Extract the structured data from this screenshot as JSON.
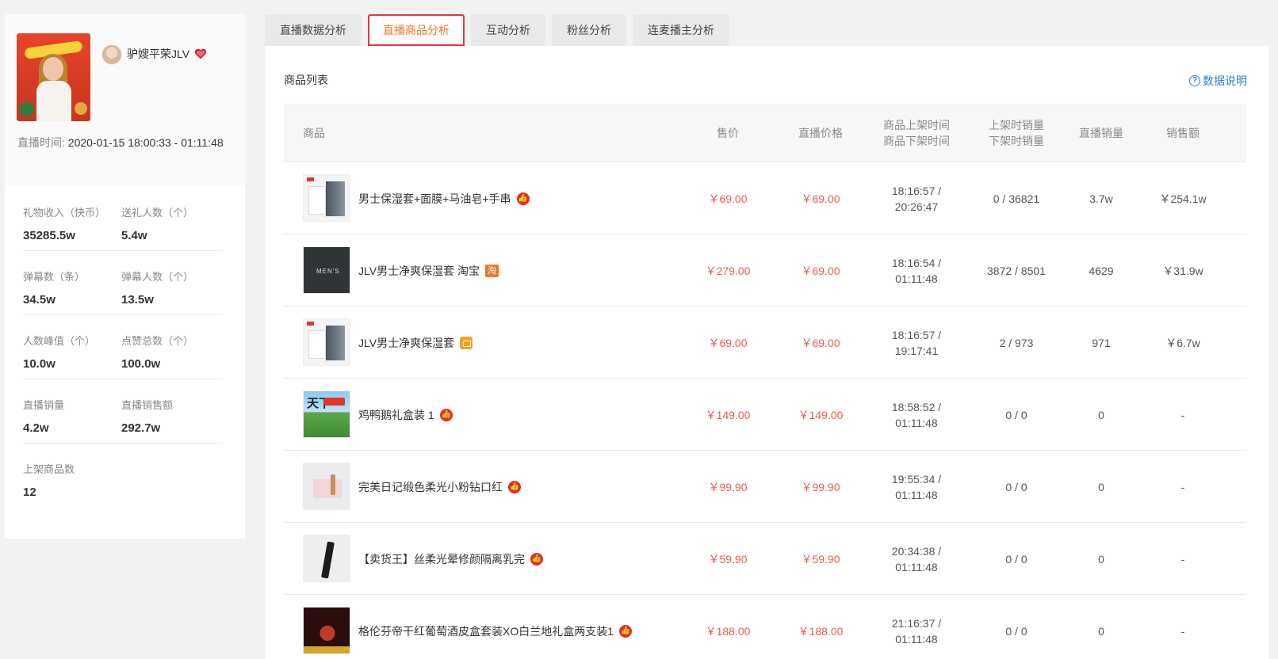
{
  "anchor": {
    "name": "驴嫂平荣JLV",
    "live_time_label": "直播时间:",
    "live_time_value": "2020-01-15 18:00:33 - 01:11:48"
  },
  "stats": [
    {
      "label": "礼物收入（快币）",
      "value": "35285.5w"
    },
    {
      "label": "送礼人数（个）",
      "value": "5.4w"
    },
    {
      "label": "弹幕数（条）",
      "value": "34.5w"
    },
    {
      "label": "弹幕人数（个）",
      "value": "13.5w"
    },
    {
      "label": "人数峰值（个）",
      "value": "10.0w"
    },
    {
      "label": "点赞总数（个）",
      "value": "100.0w"
    },
    {
      "label": "直播销量",
      "value": "4.2w"
    },
    {
      "label": "直播销售额",
      "value": "292.7w"
    },
    {
      "label": "上架商品数",
      "value": "12"
    }
  ],
  "tabs": [
    {
      "label": "直播数据分析"
    },
    {
      "label": "直播商品分析",
      "active": true
    },
    {
      "label": "互动分析"
    },
    {
      "label": "粉丝分析"
    },
    {
      "label": "连麦播主分析"
    }
  ],
  "list": {
    "title": "商品列表",
    "help": "数据说明",
    "help_icon": "?"
  },
  "columns": {
    "product": "商品",
    "price": "售价",
    "live_price": "直播价格",
    "time": "商品上架时间\n商品下架时间",
    "sales_onoff": "上架时销量\n下架时销量",
    "live_sales": "直播销量",
    "revenue": "销售额"
  },
  "products": [
    {
      "name": "男士保湿套+面膜+马油皂+手串",
      "badge": "like-badge-icon",
      "price": "￥69.00",
      "live_price": "￥69.00",
      "time": "18:16:57 /\n20:26:47",
      "sales": "0 / 36821",
      "live_sales": "3.7w",
      "revenue": "￥254.1w"
    },
    {
      "name": "JLV男士净爽保湿套 淘宝",
      "badge": "taobao-badge-icon",
      "badge_text": "淘",
      "price": "￥279.00",
      "live_price": "￥69.00",
      "time": "18:16:54 /\n01:11:48",
      "sales": "3872 / 8501",
      "live_sales": "4629",
      "revenue": "￥31.9w",
      "thumb_text": "MEN'S"
    },
    {
      "name": "JLV男士净爽保湿套",
      "badge": "shop-badge-icon",
      "price": "￥69.00",
      "live_price": "￥69.00",
      "time": "18:16:57 /\n19:17:41",
      "sales": "2 / 973",
      "live_sales": "971",
      "revenue": "￥6.7w"
    },
    {
      "name": "鸡鸭鹅礼盒装 1",
      "badge": "like-badge-icon",
      "price": "￥149.00",
      "live_price": "￥149.00",
      "time": "18:58:52 /\n01:11:48",
      "sales": "0 / 0",
      "live_sales": "0",
      "revenue": "-",
      "thumb_text": "天下"
    },
    {
      "name": "完美日记缎色柔光小粉钻口红",
      "badge": "like-badge-icon",
      "price": "￥99.90",
      "live_price": "￥99.90",
      "time": "19:55:34 /\n01:11:48",
      "sales": "0 / 0",
      "live_sales": "0",
      "revenue": "-"
    },
    {
      "name": "【卖货王】丝柔光晕修颜隔离乳完",
      "badge": "like-badge-icon",
      "price": "￥59.90",
      "live_price": "￥59.90",
      "time": "20:34:38 /\n01:11:48",
      "sales": "0 / 0",
      "live_sales": "0",
      "revenue": "-"
    },
    {
      "name": "格伦芬帝干红葡萄酒皮盒套装XO白兰地礼盒两支装1",
      "badge": "like-badge-icon",
      "price": "￥188.00",
      "live_price": "￥188.00",
      "time": "21:16:37 /\n01:11:48",
      "sales": "0 / 0",
      "live_sales": "0",
      "revenue": "-"
    }
  ],
  "colors": {
    "accent": "#f0762a",
    "price_red": "#f05a4a",
    "link_blue": "#2f7bd9",
    "tab_outline": "#e8363b"
  }
}
